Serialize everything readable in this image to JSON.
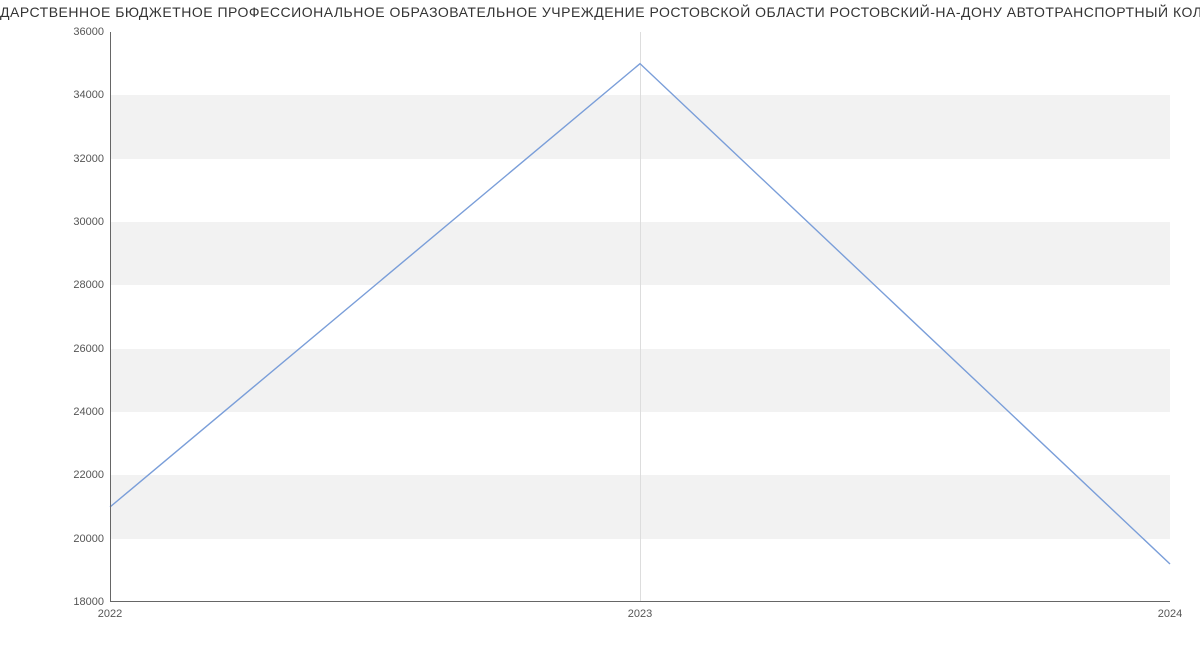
{
  "chart_data": {
    "type": "line",
    "title": "ДАРСТВЕННОЕ БЮДЖЕТНОЕ ПРОФЕССИОНАЛЬНОЕ ОБРАЗОВАТЕЛЬНОЕ УЧРЕЖДЕНИЕ РОСТОВСКОЙ ОБЛАСТИ РОСТОВСКИЙ-НА-ДОНУ АВТОТРАНСПОРТНЫЙ КОЛЛЕДЖ | Д",
    "x": [
      2022,
      2023,
      2024
    ],
    "values": [
      21000,
      35000,
      19200
    ],
    "xlabel": "",
    "ylabel": "",
    "ylim": [
      18000,
      36000
    ],
    "yticks": [
      18000,
      20000,
      22000,
      24000,
      26000,
      28000,
      30000,
      32000,
      34000,
      36000
    ],
    "xticks": [
      2022,
      2023,
      2024
    ],
    "line_color": "#7A9ED9",
    "grid_band_color": "#f2f2f2"
  }
}
